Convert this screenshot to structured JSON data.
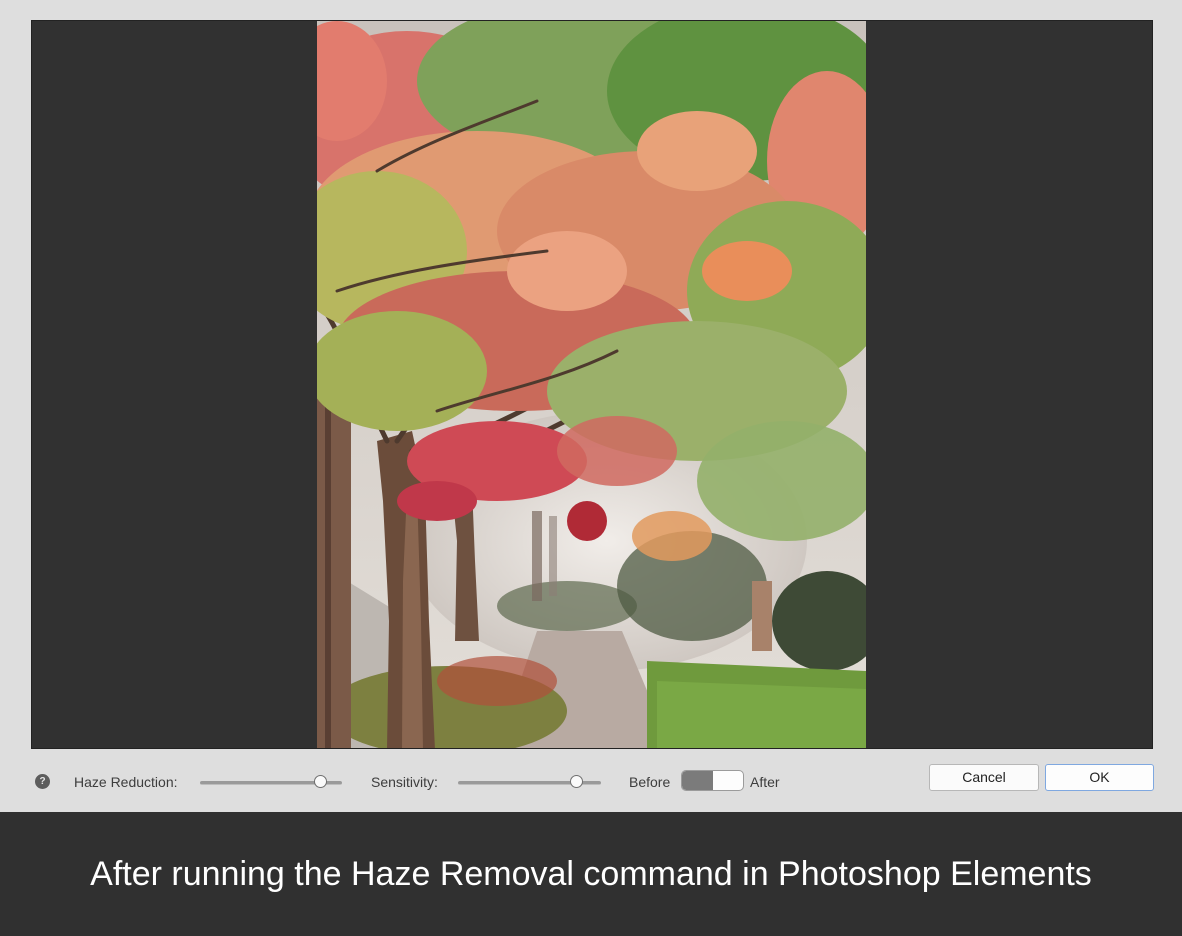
{
  "dialog": {
    "help_icon": "question-circle-icon",
    "help_glyph": "?",
    "haze_reduction": {
      "label": "Haze Reduction:",
      "value_fraction": 0.88
    },
    "sensitivity": {
      "label": "Sensitivity:",
      "value_fraction": 0.86
    },
    "before_label": "Before",
    "after_label": "After",
    "toggle_state": "before",
    "cancel_label": "Cancel",
    "ok_label": "OK"
  },
  "caption": "After running the Haze Removal command in Photoshop Elements",
  "colors": {
    "preview_bg": "#313131",
    "dialog_bg": "#dedede",
    "caption_bg": "#303030",
    "ok_border": "#7fa8e0"
  }
}
